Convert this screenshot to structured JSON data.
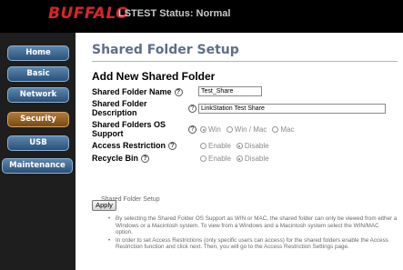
{
  "header": {
    "logo": "BUFFALO",
    "status_text": "LSTEST Status: Normal"
  },
  "sidebar": {
    "items": [
      {
        "label": "Home"
      },
      {
        "label": "Basic"
      },
      {
        "label": "Network"
      },
      {
        "label": "Security",
        "active": true
      },
      {
        "label": "USB"
      },
      {
        "label": "Maintenance"
      }
    ]
  },
  "main": {
    "page_title": "Shared Folder Setup",
    "section_title": "Add New Shared Folder",
    "fields": {
      "name_label": "Shared Folder Name",
      "name_value": "Test_Share",
      "desc_label_1": "Shared Folder",
      "desc_label_2": "Description",
      "desc_value": "LinkStation Test Share",
      "os_label_1": "Shared Folders OS",
      "os_label_2": "Support",
      "os_options": [
        "Win",
        "Win / Mac",
        "Mac"
      ],
      "os_selected": "Win",
      "access_label": "Access Restriction",
      "access_options": [
        "Enable",
        "Disable"
      ],
      "access_selected": "Disable",
      "recycle_label": "Recycle Bin",
      "recycle_options": [
        "Enable",
        "Disable"
      ],
      "recycle_selected": "Disable"
    },
    "help_icon": "?",
    "apply_label": "Apply",
    "help_title": "Shared Folder Setup",
    "help_bullets": [
      "By selecting the Shared Folder OS Support as WIN or MAC, the shared folder can only be viewed from either a Windows or a Macintosh system. To view from a Windows and a Macintosh system select the WIN/MAC option.",
      "In order to set Access Restrictions (only specific users can access) for the shared folders enable the Access Restriction function and click next. Then, you will go to the Access Restriction Settings page."
    ]
  }
}
